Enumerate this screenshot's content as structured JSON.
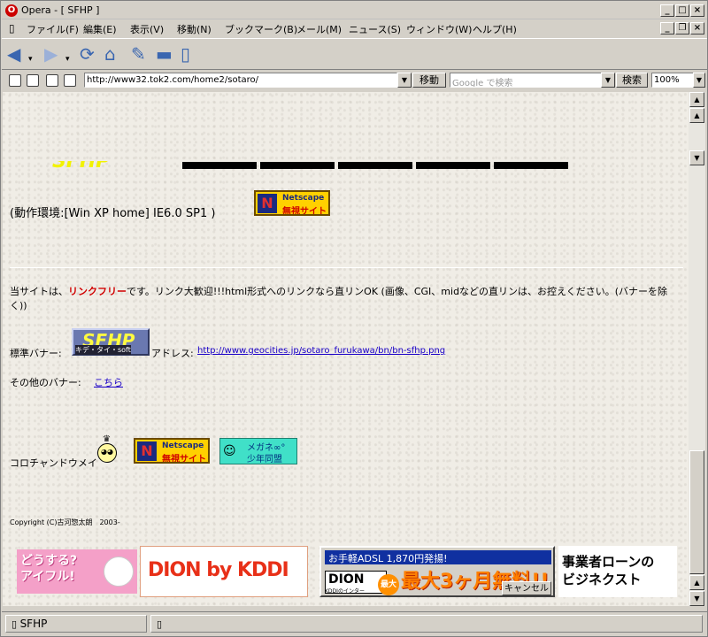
{
  "window": {
    "title": "Opera - [ SFHP ]",
    "app_icon": "opera-icon"
  },
  "menu": [
    "ファイル(F)",
    "編集(E)",
    "表示(V)",
    "移動(N)",
    "ブックマーク(B)",
    "メール(M)",
    "ニュース(S)",
    "ウィンドウ(W)",
    "ヘルプ(H)"
  ],
  "address": {
    "url": "http://www32.tok2.com/home2/sotaro/",
    "go_label": "移動",
    "search_placeholder": "Google で検索",
    "search_label": "検索",
    "zoom": "100%"
  },
  "content": {
    "env_text": "(動作環境:[Win XP home] IE6.0 SP1 )",
    "link_pre": "当サイトは、",
    "link_free": "リンクフリー",
    "link_post": "です。リンク大歓迎!!!html形式へのリンクなら直リンOK (画像、CGI、midなどの直リンは、お控えください。(バナーを除く))",
    "std_banner_label": "標準バナー:",
    "address_label": "アドレス:",
    "banner_url": "http://www.geocities.jp/sotaro_furukawa/bn/bn-sfhp.png",
    "other_banner_label": "その他のバナー:",
    "other_banner_link": "こちら",
    "korochan": "コロチャンドウメイ",
    "copyright": "Copyright (C)古河惣太朗　2003-",
    "sfhp_banner": "SFHP",
    "sfhp_banner_sub": "キデ・タイ・soft",
    "ns_banner_line1": "Netscape",
    "ns_banner_line2": "無視サイト",
    "megane_line1": "メガネ∞°",
    "megane_line2": "少年同盟"
  },
  "ads": {
    "aiful": "どうする?\nアイフル!",
    "dion": "DION by KDDI",
    "adsl_line": "お手軽ADSL 1,870円発揚!",
    "adsl_big": "最大3ヶ月無料!!",
    "adsl_dion": "DION",
    "adsl_kddi": "KDDIのインター",
    "adsl_max": "最大",
    "adsl_cancel": "キャンセル",
    "loan": "事業者ローンの\nビジネクスト"
  },
  "status": {
    "tab_label": "SFHP"
  },
  "colors": {
    "link": "#1a00c8",
    "link_free": "#d00000",
    "page_bg": "#f0ede6",
    "chrome": "#d4d0c8"
  }
}
